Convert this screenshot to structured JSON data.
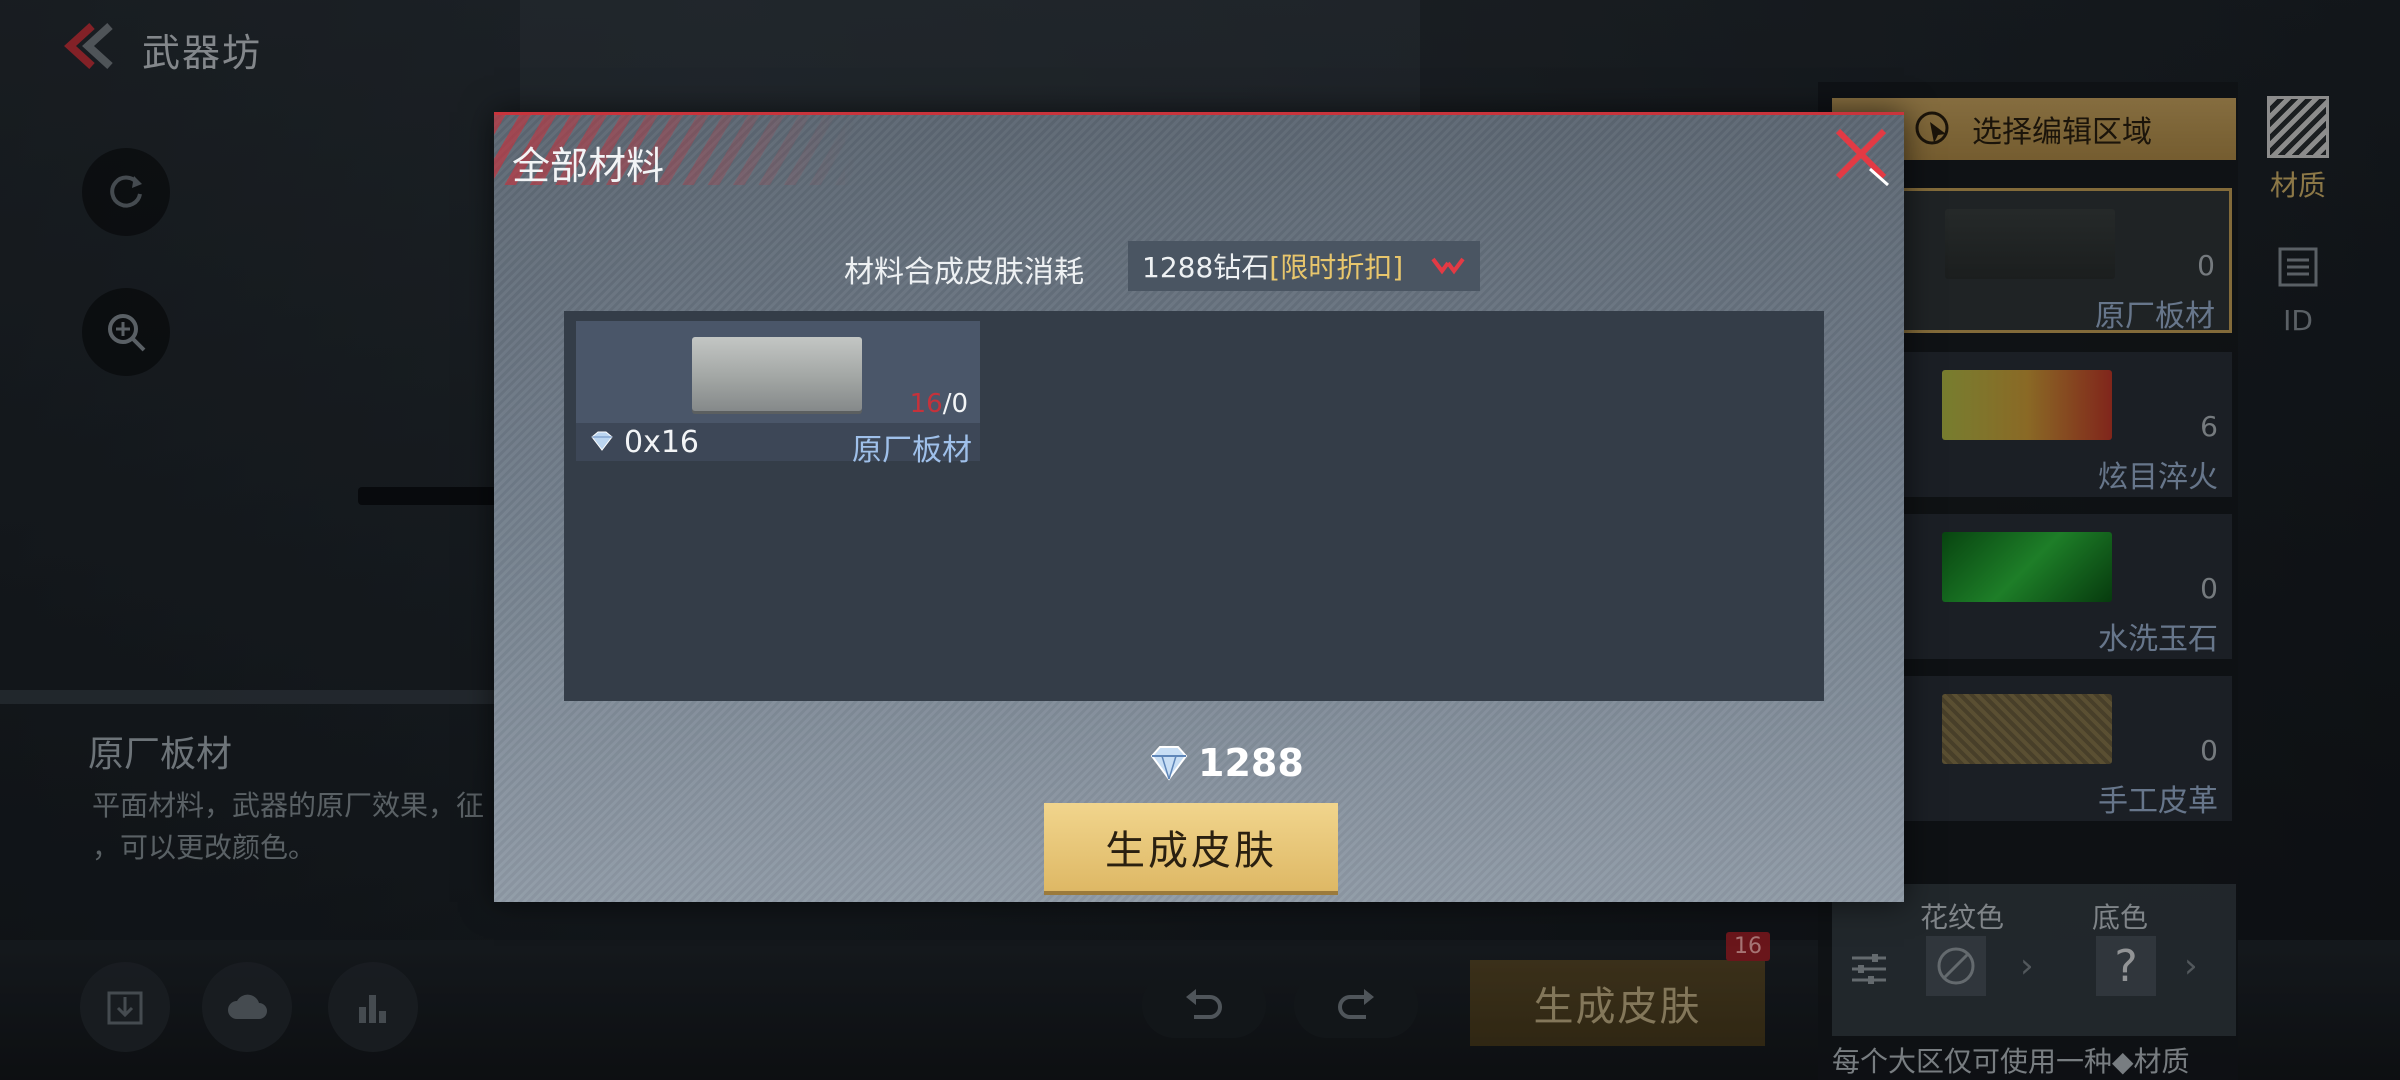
{
  "header": {
    "title": "武器坊"
  },
  "info": {
    "title": "原厂板材",
    "description": "平面材料，武器的原厂效果，征\n，可以更改颜色。"
  },
  "right_panel": {
    "select_region": "选择编辑区域",
    "tabs": [
      {
        "label": "材质"
      },
      {
        "label": "ID"
      }
    ],
    "materials": [
      {
        "name": "原厂板材",
        "count": "0",
        "edge": ""
      },
      {
        "name": "炫目淬火",
        "count": "6",
        "edge": "0"
      },
      {
        "name": "水洗玉石",
        "count": "0",
        "edge": "0"
      },
      {
        "name": "手工皮革",
        "count": "0",
        "edge": "0"
      }
    ],
    "pattern_color_label": "花纹色",
    "base_color_label": "底色",
    "base_color_value": "?",
    "footer_note": "每个大区仅可使用一种◆材质"
  },
  "bottom": {
    "generate_label": "生成皮肤",
    "badge": "16"
  },
  "modal": {
    "title": "全部材料",
    "cost_label": "材料合成皮肤消耗",
    "cost_value": "1288钻石",
    "cost_discount": "[限时折扣]",
    "item": {
      "name": "原厂板材",
      "have": "16",
      "need": "/0",
      "cost": "0x16"
    },
    "total": "1288",
    "generate_label": "生成皮肤"
  },
  "colors": {
    "accent_red": "#c9343c",
    "gold": "#deb865",
    "item_name_blue": "#9fc0ea"
  }
}
